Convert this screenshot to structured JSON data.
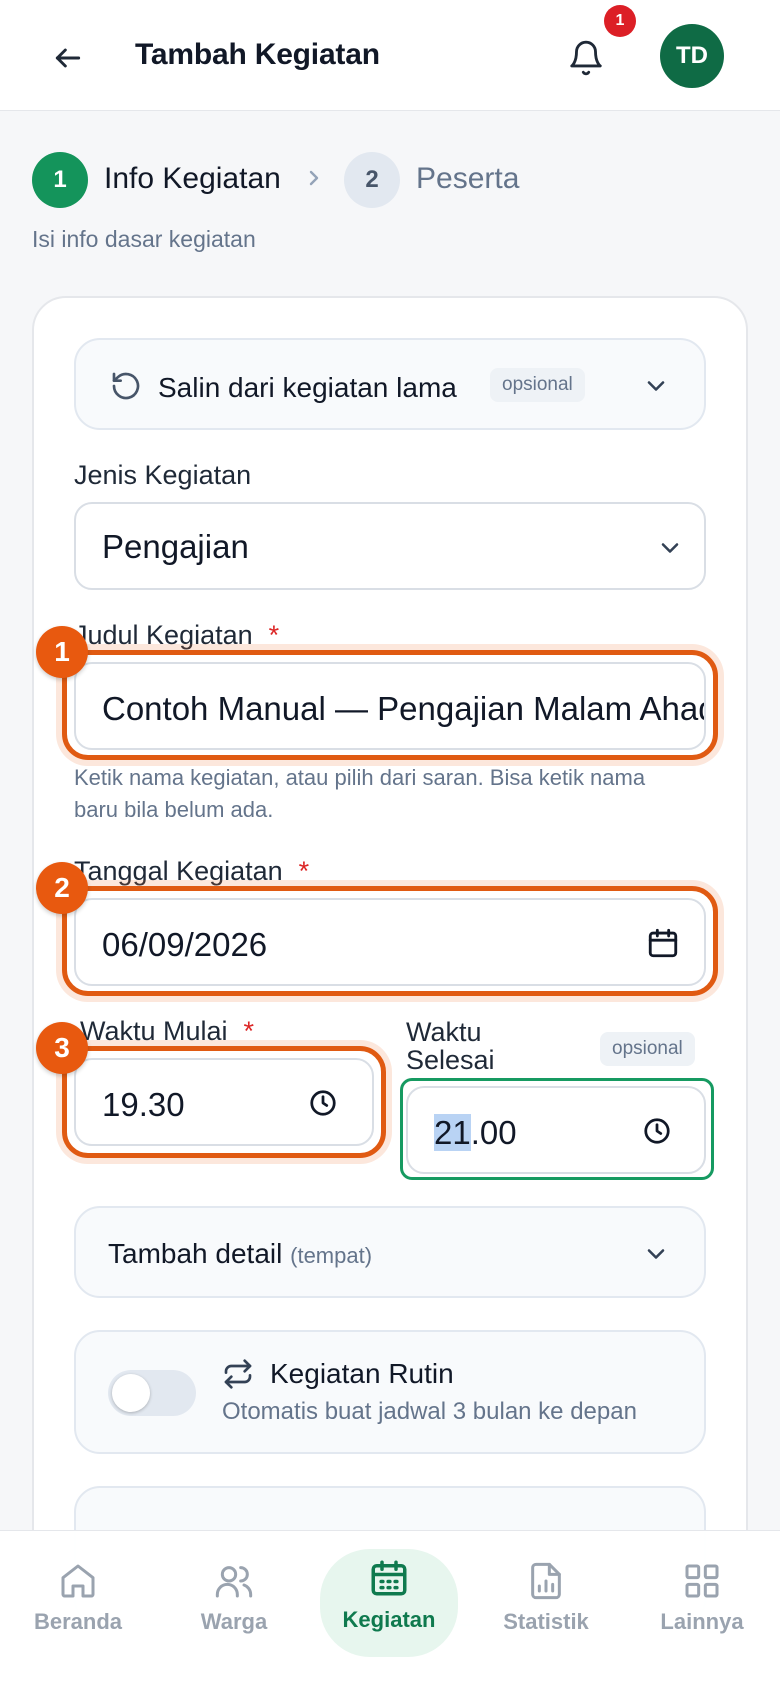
{
  "header": {
    "title": "Tambah Kegiatan",
    "notification_count": "1",
    "avatar_initials": "TD"
  },
  "stepper": {
    "steps": [
      {
        "number": "1",
        "label": "Info Kegiatan",
        "active": true
      },
      {
        "number": "2",
        "label": "Peserta",
        "active": false
      }
    ],
    "subtitle": "Isi info dasar kegiatan"
  },
  "copy_section": {
    "label": "Salin dari kegiatan lama",
    "badge": "opsional"
  },
  "form": {
    "jenis": {
      "label": "Jenis Kegiatan",
      "value": "Pengajian"
    },
    "judul": {
      "label": "Judul Kegiatan",
      "required_mark": "*",
      "value": "Contoh Manual — Pengajian Malam Ahad",
      "help": "Ketik nama kegiatan, atau pilih dari saran. Bisa ketik nama baru bila belum ada."
    },
    "tanggal": {
      "label": "Tanggal Kegiatan",
      "required_mark": "*",
      "value": "06/09/2026"
    },
    "waktu_mulai": {
      "label": "Waktu Mulai",
      "required_mark": "*",
      "value": "19.30"
    },
    "waktu_selesai": {
      "label_line1": "Waktu",
      "label_line2": "Selesai",
      "badge": "opsional",
      "value_selected": "21",
      "value_rest": ".00"
    }
  },
  "detail_section": {
    "label": "Tambah detail",
    "sub": "(tempat)"
  },
  "rutin": {
    "enabled": false,
    "title": "Kegiatan Rutin",
    "subtitle": "Otomatis buat jadwal 3 bulan ke depan"
  },
  "markers": [
    "1",
    "2",
    "3"
  ],
  "bottom_nav": [
    {
      "label": "Beranda",
      "icon": "home-icon"
    },
    {
      "label": "Warga",
      "icon": "users-icon"
    },
    {
      "label": "Kegiatan",
      "icon": "calendar-icon",
      "active": true
    },
    {
      "label": "Statistik",
      "icon": "chart-file-icon"
    },
    {
      "label": "Lainnya",
      "icon": "grid-icon"
    }
  ],
  "colors": {
    "primary": "#14945b",
    "avatar": "#0f6b45",
    "badge": "#dc1f26",
    "highlight": "#e05a12",
    "focus": "#169a61"
  }
}
